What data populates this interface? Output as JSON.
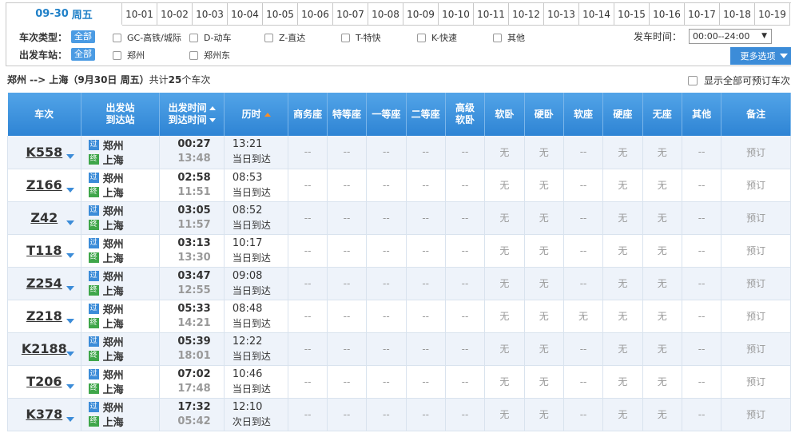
{
  "date_tabs": {
    "active": {
      "date": "09-30",
      "weekday": "周五"
    },
    "others": [
      "10-01",
      "10-02",
      "10-03",
      "10-04",
      "10-05",
      "10-06",
      "10-07",
      "10-08",
      "10-09",
      "10-10",
      "10-11",
      "10-12",
      "10-13",
      "10-14",
      "10-15",
      "10-16",
      "10-17",
      "10-18",
      "10-19"
    ]
  },
  "filters": {
    "type_label": "车次类型：",
    "station_label": "出发车站：",
    "all_label": "全部",
    "types": [
      "GC-高铁/城际",
      "D-动车",
      "Z-直达",
      "T-特快",
      "K-快速",
      "其他"
    ],
    "stations": [
      "郑州",
      "郑州东"
    ],
    "dep_time_label": "发车时间：",
    "dep_time_value": "00:00--24:00",
    "more_label": "更多选项"
  },
  "summary": {
    "route": "郑州 --> 上海（9月30日  周五）",
    "count_prefix": "共计",
    "count": "25",
    "count_suffix": "个车次",
    "show_bookable": "显示全部可预订车次"
  },
  "table": {
    "headers": {
      "train": "车次",
      "station_1": "出发站",
      "station_2": "到达站",
      "time_1": "出发时间",
      "time_2": "到达时间",
      "duration": "历时",
      "business": "商务座",
      "premium": "特等座",
      "first": "一等座",
      "second": "二等座",
      "soft_sleeper_hi_1": "高级",
      "soft_sleeper_hi_2": "软卧",
      "soft_sleeper": "软卧",
      "hard_sleeper": "硬卧",
      "soft_seat": "软座",
      "hard_seat": "硬座",
      "standing": "无座",
      "other": "其他",
      "note": "备注"
    },
    "icon_pass": "过",
    "icon_end": "终",
    "rows": [
      {
        "train": "K558",
        "from": "郑州",
        "to": "上海",
        "dep": "00:27",
        "arr": "13:48",
        "dur": "13:21",
        "note": "当日到达",
        "seats": [
          "--",
          "--",
          "--",
          "--",
          "--",
          "无",
          "无",
          "--",
          "无",
          "无",
          "--"
        ],
        "book": "预订"
      },
      {
        "train": "Z166",
        "from": "郑州",
        "to": "上海",
        "dep": "02:58",
        "arr": "11:51",
        "dur": "08:53",
        "note": "当日到达",
        "seats": [
          "--",
          "--",
          "--",
          "--",
          "--",
          "无",
          "无",
          "--",
          "无",
          "无",
          "--"
        ],
        "book": "预订"
      },
      {
        "train": "Z42",
        "from": "郑州",
        "to": "上海",
        "dep": "03:05",
        "arr": "11:57",
        "dur": "08:52",
        "note": "当日到达",
        "seats": [
          "--",
          "--",
          "--",
          "--",
          "--",
          "无",
          "无",
          "--",
          "无",
          "无",
          "--"
        ],
        "book": "预订"
      },
      {
        "train": "T118",
        "from": "郑州",
        "to": "上海",
        "dep": "03:13",
        "arr": "13:30",
        "dur": "10:17",
        "note": "当日到达",
        "seats": [
          "--",
          "--",
          "--",
          "--",
          "--",
          "无",
          "无",
          "--",
          "无",
          "无",
          "--"
        ],
        "book": "预订"
      },
      {
        "train": "Z254",
        "from": "郑州",
        "to": "上海",
        "dep": "03:47",
        "arr": "12:55",
        "dur": "09:08",
        "note": "当日到达",
        "seats": [
          "--",
          "--",
          "--",
          "--",
          "--",
          "无",
          "无",
          "--",
          "无",
          "无",
          "--"
        ],
        "book": "预订"
      },
      {
        "train": "Z218",
        "from": "郑州",
        "to": "上海",
        "dep": "05:33",
        "arr": "14:21",
        "dur": "08:48",
        "note": "当日到达",
        "seats": [
          "--",
          "--",
          "--",
          "--",
          "--",
          "无",
          "无",
          "无",
          "无",
          "无",
          "--"
        ],
        "book": "预订"
      },
      {
        "train": "K2188",
        "from": "郑州",
        "to": "上海",
        "dep": "05:39",
        "arr": "18:01",
        "dur": "12:22",
        "note": "当日到达",
        "seats": [
          "--",
          "--",
          "--",
          "--",
          "--",
          "无",
          "无",
          "--",
          "无",
          "无",
          "--"
        ],
        "book": "预订"
      },
      {
        "train": "T206",
        "from": "郑州",
        "to": "上海",
        "dep": "07:02",
        "arr": "17:48",
        "dur": "10:46",
        "note": "当日到达",
        "seats": [
          "--",
          "--",
          "--",
          "--",
          "--",
          "无",
          "无",
          "--",
          "无",
          "无",
          "--"
        ],
        "book": "预订"
      },
      {
        "train": "K378",
        "from": "郑州",
        "to": "上海",
        "dep": "17:32",
        "arr": "05:42",
        "dur": "12:10",
        "note": "次日到达",
        "seats": [
          "--",
          "--",
          "--",
          "--",
          "--",
          "无",
          "无",
          "--",
          "无",
          "无",
          "--"
        ],
        "book": "预订"
      }
    ]
  }
}
